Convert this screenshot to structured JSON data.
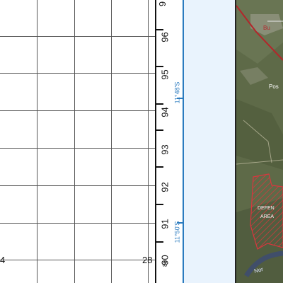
{
  "grid": {
    "easting_labels": [
      {
        "text": "4"
      },
      {
        "text": "28"
      }
    ],
    "northing_labels": [
      "96",
      "95",
      "94",
      "93",
      "92",
      "91",
      "90"
    ],
    "northing_partial_top": "9",
    "small_label": "86"
  },
  "latitude_labels": [
    "11°48'S",
    "11°50'S"
  ],
  "map": {
    "place_labels": [
      "Bu",
      "Pos",
      "DEFEN",
      "AREA",
      "Nor"
    ],
    "colors": {
      "defence_area": "#d9363e",
      "road": "#b3262b",
      "grid_blue": "#2b7bbf"
    }
  }
}
